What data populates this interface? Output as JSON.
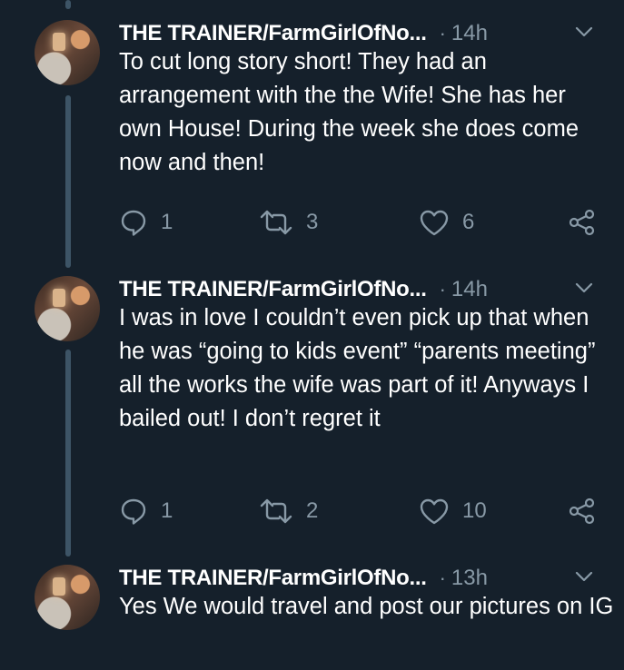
{
  "tweets": [
    {
      "author": "THE TRAINER/FarmGirlOfNo...",
      "separator": "·",
      "time": "14h",
      "text": "To cut long story short! They had an arrangement with the the Wife! She has her own House! During the week she does come now and then!",
      "replies": "1",
      "retweets": "3",
      "likes": "6"
    },
    {
      "author": "THE TRAINER/FarmGirlOfNo...",
      "separator": "·",
      "time": "14h",
      "text": "I was in love I couldn’t even pick up that when he was “going to kids event” “parents meeting” all the works the wife was part of it! Anyways I bailed out! I don’t regret it",
      "replies": "1",
      "retweets": "2",
      "likes": "10"
    },
    {
      "author": "THE TRAINER/FarmGirlOfNo...",
      "separator": "·",
      "time": "13h",
      "text": "Yes We would travel and post our pictures on IG"
    }
  ],
  "colors": {
    "background": "#15202b",
    "secondary_text": "#8899a6",
    "thread_line": "#3d5466"
  },
  "icons": [
    "reply-icon",
    "retweet-icon",
    "like-icon",
    "share-icon",
    "chevron-down-icon"
  ]
}
